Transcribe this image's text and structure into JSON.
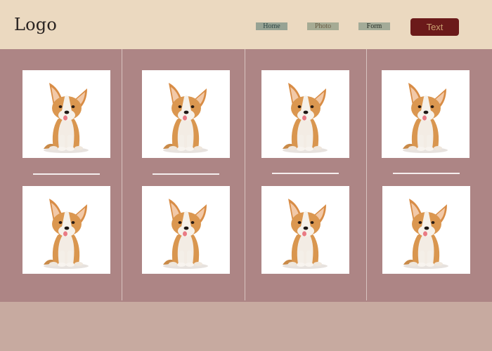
{
  "header": {
    "logo": "Logo",
    "nav": [
      {
        "label": "Home"
      },
      {
        "label": "Photo"
      },
      {
        "label": "Form"
      }
    ],
    "cta_label": "Text"
  },
  "gallery": {
    "image_subject": "corgi-puppy",
    "rows": 2,
    "columns": 4
  },
  "colors": {
    "header_bg": "#ebd9c0",
    "gallery_bg": "#ad8585",
    "footer_bg": "#c7aaa0",
    "cta_bg": "#6b1a1a",
    "cta_text": "#c9a070"
  }
}
